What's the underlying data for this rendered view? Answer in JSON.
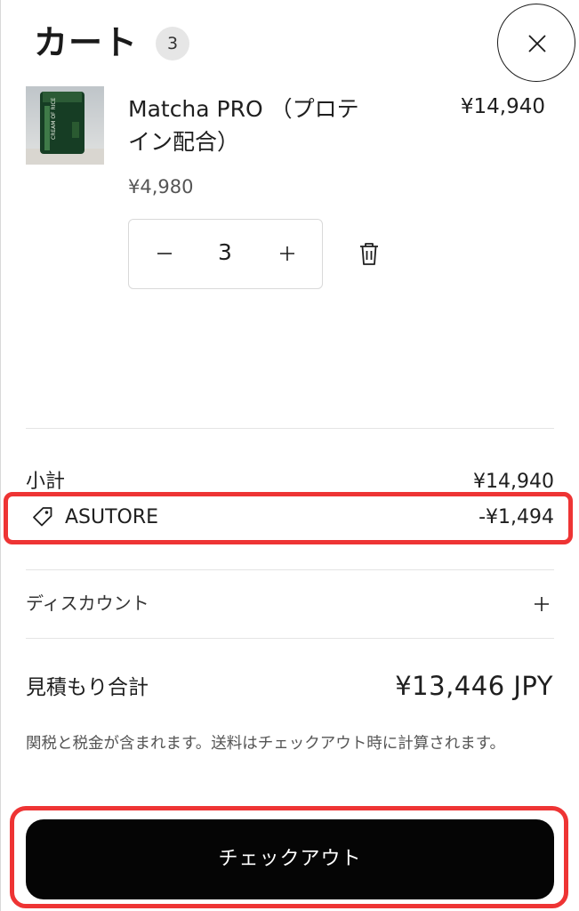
{
  "header": {
    "title": "カート",
    "item_count": "3",
    "close_icon": "close-icon"
  },
  "item": {
    "name": "Matcha PRO （プロテイン配合）",
    "line_total": "¥14,940",
    "unit_price": "¥4,980",
    "quantity": "3",
    "thumbnail_label": "CREAM OF RICE",
    "icons": {
      "decrease": "minus-icon",
      "increase": "plus-icon",
      "remove": "trash-icon"
    }
  },
  "summary": {
    "subtotal_label": "小計",
    "subtotal_value": "¥14,940",
    "discount_code": "ASUTORE",
    "discount_amount": "-¥1,494",
    "discount_label": "ディスカウント",
    "total_label": "見積もり合計",
    "total_value": "¥13,446 JPY",
    "tax_note": "関税と税金が含まれます。送料はチェックアウト時に計算されます。"
  },
  "checkout": {
    "label": "チェックアウト"
  },
  "colors": {
    "highlight": "#ee3434",
    "button_bg": "#050505",
    "badge_bg": "#e6e6e6"
  }
}
